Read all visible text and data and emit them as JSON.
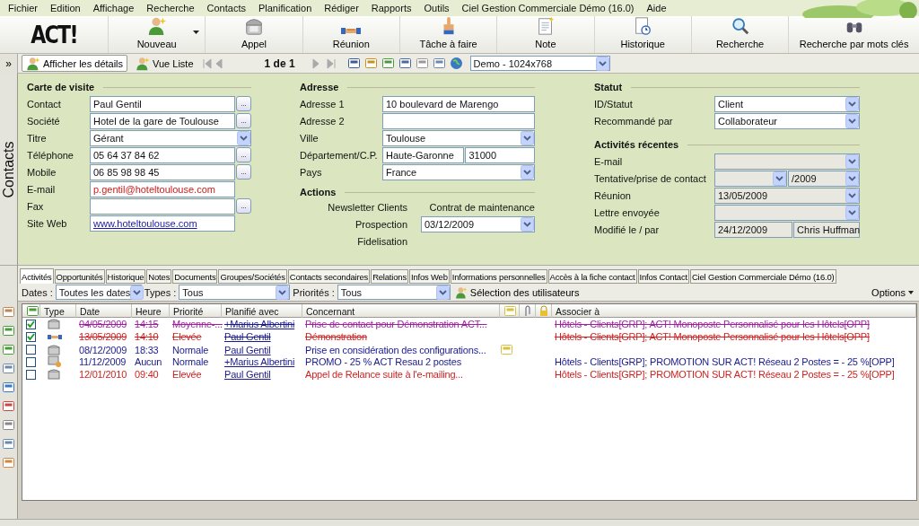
{
  "menu": [
    "Fichier",
    "Edition",
    "Affichage",
    "Recherche",
    "Contacts",
    "Planification",
    "Rédiger",
    "Rapports",
    "Outils",
    "Ciel Gestion Commerciale Démo (16.0)",
    "Aide"
  ],
  "logo": "ACT!",
  "toolbar": [
    {
      "label": "Nouveau",
      "dropdown": true
    },
    {
      "label": "Appel",
      "dropdown": false
    },
    {
      "label": "Réunion",
      "dropdown": false
    },
    {
      "label": "Tâche à faire",
      "dropdown": false
    },
    {
      "label": "Note",
      "dropdown": false
    },
    {
      "label": "Historique",
      "dropdown": false
    },
    {
      "label": "Recherche",
      "dropdown": false
    },
    {
      "label": "Recherche par mots clés",
      "dropdown": false
    }
  ],
  "nav": {
    "expand": "»",
    "views": [
      {
        "label": "Afficher les détails",
        "selected": true
      },
      {
        "label": "Vue Liste",
        "selected": false
      }
    ],
    "record": "1 de 1",
    "layout": "Demo - 1024x768"
  },
  "side_label": "Contacts",
  "business_card": {
    "title": "Carte de visite",
    "fields": [
      {
        "label": "Contact",
        "kind": "lookup",
        "value": "Paul Gentil",
        "button": "..."
      },
      {
        "label": "Société",
        "kind": "lookup",
        "value": "Hotel de la gare de Toulouse",
        "button": "..."
      },
      {
        "label": "Titre",
        "kind": "combo",
        "value": "Gérant"
      },
      {
        "label": "Téléphone",
        "kind": "lookup",
        "value": "05 64 37 84 62",
        "button": "..."
      },
      {
        "label": "Mobile",
        "kind": "lookup",
        "value": "06 85 98 98 45",
        "button": "..."
      },
      {
        "label": "E-mail",
        "kind": "email",
        "value": "p.gentil@hoteltoulouse.com"
      },
      {
        "label": "Fax",
        "kind": "lookup",
        "button": "..."
      },
      {
        "label": "Site Web",
        "kind": "link",
        "value": "www.hoteltoulouse.com"
      }
    ]
  },
  "address": {
    "title": "Adresse",
    "fields": [
      {
        "label": "Adresse 1",
        "kind": "text",
        "value": "10 boulevard de Marengo"
      },
      {
        "label": "Adresse 2",
        "kind": "text"
      },
      {
        "label": "Ville",
        "kind": "combo",
        "value": "Toulouse"
      },
      {
        "label": "Département/C.P.",
        "kind": "pair",
        "values": [
          "Haute-Garonne",
          "31000"
        ]
      },
      {
        "label": "Pays",
        "kind": "combo",
        "value": "France"
      }
    ]
  },
  "actions": {
    "title": "Actions",
    "items": [
      {
        "label": "Newsletter Clients"
      },
      {
        "label": "Contrat de maintenance"
      },
      {
        "label": "Prospection",
        "value": "03/12/2009"
      },
      {
        "label": "Fidelisation"
      }
    ]
  },
  "status": {
    "title": "Statut",
    "fields": [
      {
        "label": "ID/Statut",
        "kind": "combo",
        "value": "Client"
      },
      {
        "label": "Recommandé par",
        "kind": "combo",
        "value": "Collaborateur"
      }
    ]
  },
  "recent": {
    "title": "Activités récentes",
    "fields": [
      {
        "label": "E-mail",
        "kind": "combo",
        "readonly": true
      },
      {
        "label": "Tentative/prise de contact",
        "kind": "split-combo",
        "value": "/2009",
        "readonly": true
      },
      {
        "label": "Réunion",
        "kind": "combo",
        "value": "13/05/2009",
        "readonly": true
      },
      {
        "label": "Lettre envoyée",
        "kind": "combo",
        "readonly": true
      },
      {
        "label": "Modifié le / par",
        "kind": "pair",
        "values": [
          "24/12/2009",
          "Chris Huffman"
        ],
        "readonly": true
      }
    ]
  },
  "tabs": [
    {
      "label": "Activités",
      "selected": true
    },
    {
      "label": "Opportunités",
      "selected": false
    },
    {
      "label": "Historique",
      "selected": false
    },
    {
      "label": "Notes",
      "selected": false
    },
    {
      "label": "Documents",
      "selected": false
    },
    {
      "label": "Groupes/Sociétés",
      "selected": false
    },
    {
      "label": "Contacts secondaires",
      "selected": false
    },
    {
      "label": "Relations",
      "selected": false
    },
    {
      "label": "Infos Web",
      "selected": false
    },
    {
      "label": "Informations personnelles",
      "selected": false
    },
    {
      "label": "Accès à la fiche contact",
      "selected": false
    },
    {
      "label": "Infos Contact",
      "selected": false
    },
    {
      "label": "Ciel Gestion Commerciale Démo (16.0)",
      "selected": false
    }
  ],
  "filters": {
    "dates_label": "Dates :",
    "dates": "Toutes les dates",
    "types_label": "Types :",
    "types": "Tous",
    "priorities_label": "Priorités :",
    "priorities": "Tous",
    "users_button": "Sélection des utilisateurs",
    "options": "Options"
  },
  "table": {
    "columns": [
      "Type",
      "Date",
      "Heure",
      "Priorité",
      "Planifié avec",
      "Concernant",
      "Associer à"
    ],
    "rows": [
      {
        "done": true,
        "kind": "call",
        "date": "04/05/2009",
        "time": "14:15",
        "priority": "Moyenne-...",
        "with": "+Marius Albertini",
        "regarding": "Prise de contact pour Démonstration ACT...",
        "note": false,
        "associate": "Hôtels - Clients[GRP]; ACT! Monoposte Personnalisé pour les Hôtels[OPP]",
        "color": "#a01fa0"
      },
      {
        "done": true,
        "kind": "meeting",
        "date": "13/05/2009",
        "time": "14:10",
        "priority": "Elevée",
        "with": "Paul Gentil",
        "regarding": "Démonstration",
        "note": false,
        "associate": "Hôtels - Clients[GRP]; ACT! Monoposte Personnalisé pour les Hôtels[OPP]",
        "color": "#d42020"
      },
      {
        "done": false,
        "kind": "call",
        "date": "08/12/2009",
        "time": "18:33",
        "priority": "Normale",
        "with": "Paul Gentil",
        "regarding": "Prise en considération des configurations...",
        "note": true,
        "color": "#1a1a90"
      },
      {
        "done": false,
        "kind": "todo",
        "date": "11/12/2009",
        "time": "Aucun",
        "priority": "Normale",
        "with": "+Marius Albertini",
        "regarding": "PROMO - 25 % ACT Resau 2 postes",
        "note": false,
        "associate": "Hôtels - Clients[GRP]; PROMOTION SUR ACT! Réseau 2 Postes = - 25 %[OPP]",
        "color": "#1a1a90"
      },
      {
        "done": false,
        "kind": "call",
        "date": "12/01/2010",
        "time": "09:40",
        "priority": "Elevée",
        "with": "Paul Gentil",
        "regarding": "Appel de Relance suite à l'e-mailing...",
        "note": false,
        "associate": "Hôtels - Clients[GRP]; PROMOTION SUR ACT! Réseau 2 Postes = - 25 %[OPP]",
        "color": "#d42020"
      }
    ]
  }
}
